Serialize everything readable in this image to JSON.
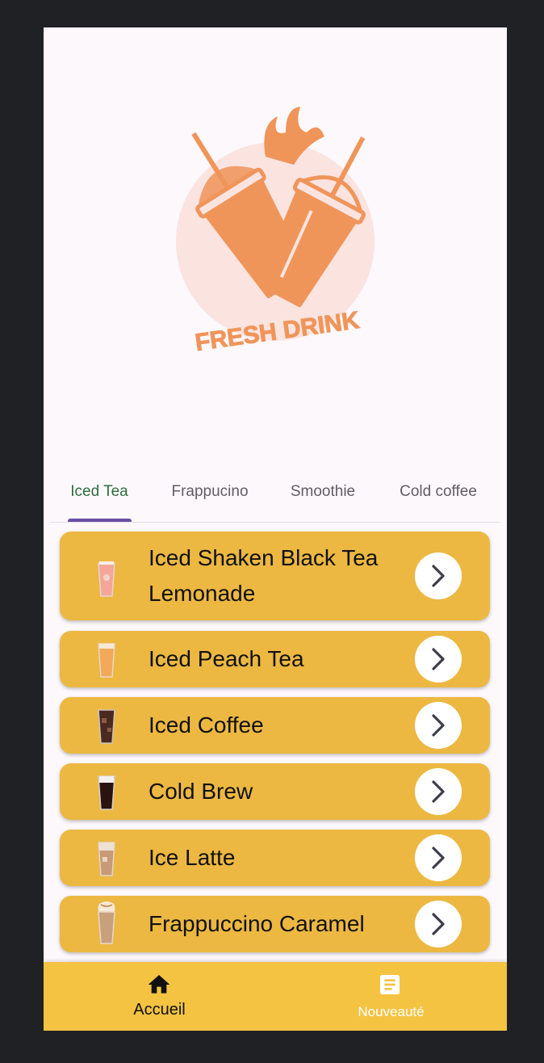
{
  "logo": {
    "brand_text": "FRESH DRINK"
  },
  "tabs": [
    {
      "label": "Iced Tea",
      "active": true
    },
    {
      "label": "Frappucino",
      "active": false
    },
    {
      "label": "Smoothie",
      "active": false
    },
    {
      "label": "Cold coffee",
      "active": false
    }
  ],
  "drinks": [
    {
      "name": "Iced Shaken Black Tea Lemonade",
      "thumb": "pink-iced-tea-glass"
    },
    {
      "name": "Iced Peach Tea",
      "thumb": "peach-tea-glass"
    },
    {
      "name": "Iced Coffee",
      "thumb": "iced-coffee-glass"
    },
    {
      "name": "Cold Brew",
      "thumb": "cold-brew-glass"
    },
    {
      "name": "Ice Latte",
      "thumb": "iced-latte-glass"
    },
    {
      "name": "Frappuccino Caramel",
      "thumb": "caramel-frappuccino-glass"
    }
  ],
  "bottom_nav": {
    "home_label": "Accueil",
    "news_label": "Nouveauté",
    "home_icon": "home-icon",
    "news_icon": "article-icon"
  },
  "colors": {
    "accent_yellow": "#ecb842",
    "nav_yellow": "#f4c342",
    "logo_orange": "#f0955a",
    "logo_circle": "#fbe3e0",
    "active_tab": "#2e6e3f",
    "indicator": "#6750a4"
  }
}
